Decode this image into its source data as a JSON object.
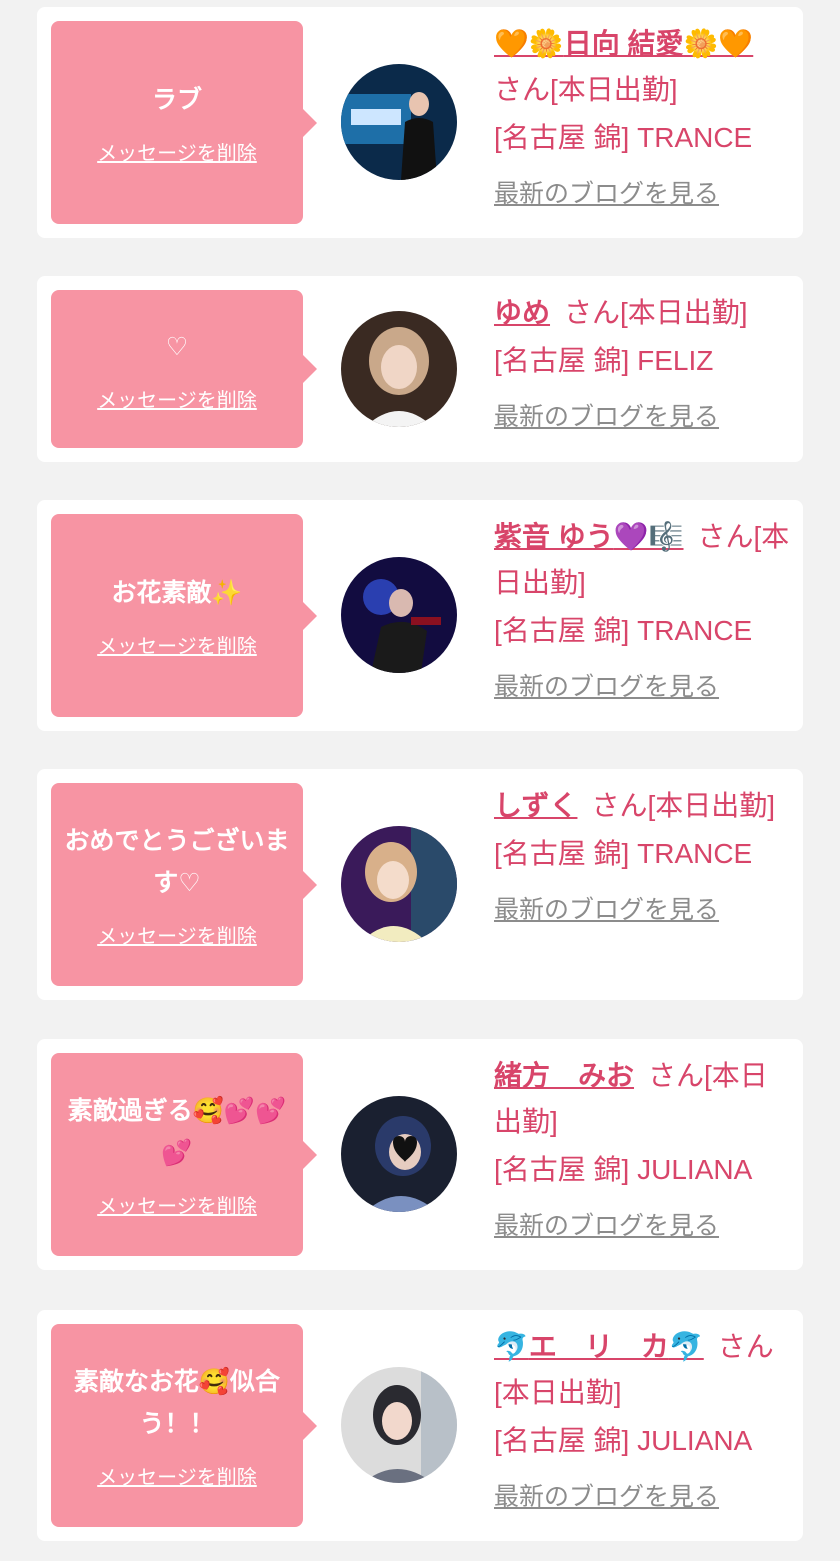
{
  "delete_label": "メッセージを削除",
  "blog_label": "最新のブログを見る",
  "colors": {
    "bubble": "#f794a3",
    "name": "#d8456a",
    "link_gray": "#8c8c8c",
    "background": "#f2f2f2"
  },
  "entries": [
    {
      "message": "ラブ",
      "name_prefix": "🧡🌼",
      "name": "日向 結愛",
      "name_suffix": "🌼🧡",
      "status": "さん[本日出勤]",
      "shop": "[名古屋 錦] TRANCE",
      "avatar": "portrait-photo"
    },
    {
      "message": "♡",
      "name_prefix": "",
      "name": "ゆめ",
      "name_suffix": "",
      "status": "さん[本日出勤]",
      "shop": "[名古屋 錦] FELIZ",
      "avatar": "portrait-photo"
    },
    {
      "message": "お花素敵✨",
      "name_prefix": "",
      "name": "紫音 ゆう",
      "name_suffix": "💜🎼",
      "status": "さん[本日出勤]",
      "shop": "[名古屋 錦] TRANCE",
      "avatar": "portrait-photo"
    },
    {
      "message": "おめでとうございます♡",
      "name_prefix": "",
      "name": "しずく",
      "name_suffix": "",
      "status": "さん[本日出勤]",
      "shop": "[名古屋 錦] TRANCE",
      "avatar": "portrait-photo"
    },
    {
      "message": "素敵過ぎる🥰💕💕💕",
      "name_prefix": "",
      "name": "緒方　みお",
      "name_suffix": "",
      "status": "さん[本日出勤]",
      "shop": "[名古屋 錦] JULIANA",
      "avatar": "portrait-photo"
    },
    {
      "message": "素敵なお花🥰似合う！！",
      "name_prefix": "🐬",
      "name": "エ　リ　カ",
      "name_suffix": "🐬",
      "status": "さん[本日出勤]",
      "shop": "[名古屋 錦] JULIANA",
      "avatar": "portrait-photo"
    }
  ]
}
